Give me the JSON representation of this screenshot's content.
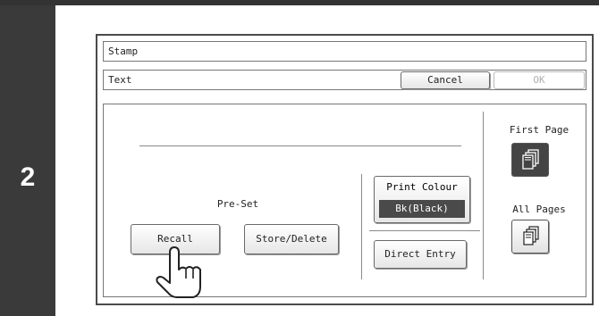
{
  "step": {
    "number": "2"
  },
  "header": {
    "title": "Stamp"
  },
  "subheader": {
    "title": "Text",
    "cancel_label": "Cancel",
    "ok_label": "OK"
  },
  "preset": {
    "label": "Pre-Set",
    "recall_label": "Recall",
    "store_delete_label": "Store/Delete"
  },
  "print_colour": {
    "label": "Print Colour",
    "value": "Bk(Black)"
  },
  "direct_entry": {
    "label": "Direct Entry"
  },
  "pages": {
    "first_label": "First Page",
    "all_label": "All Pages",
    "selected": "first"
  },
  "colors": {
    "selected_bg": "#444444",
    "step_bg": "#3a3a3a"
  }
}
